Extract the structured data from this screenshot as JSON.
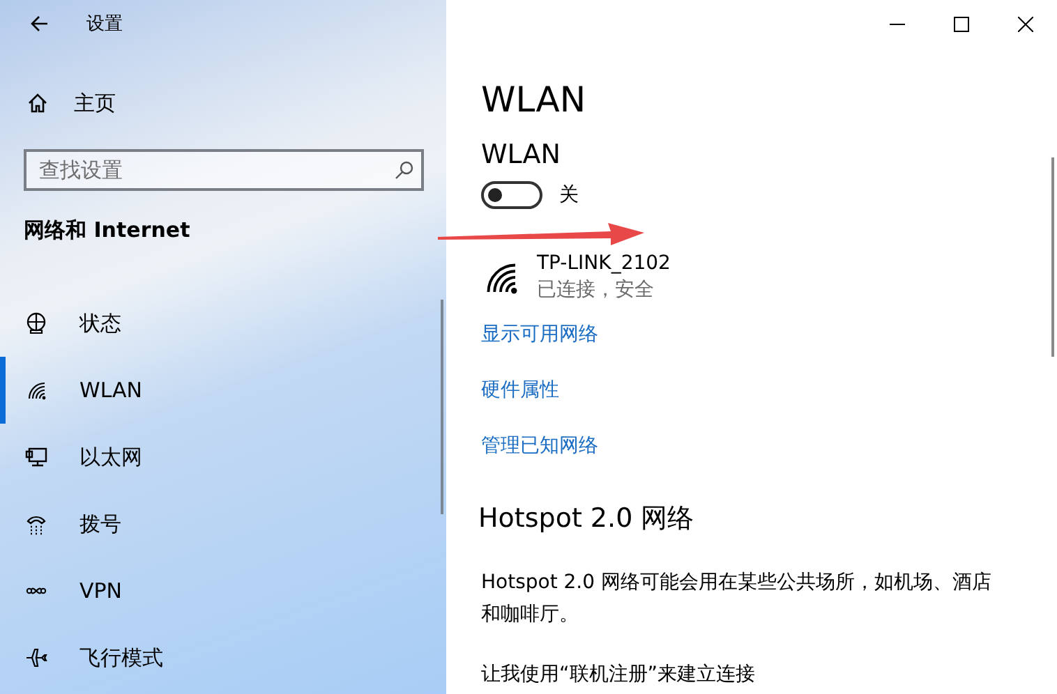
{
  "window": {
    "title": "设置"
  },
  "sidebar": {
    "home": {
      "label": "主页"
    },
    "search": {
      "placeholder": "查找设置"
    },
    "section_title": "网络和 Internet",
    "items": [
      {
        "label": "状态",
        "kind": "globe",
        "selected": false
      },
      {
        "label": "WLAN",
        "kind": "wifi",
        "selected": true
      },
      {
        "label": "以太网",
        "kind": "ethernet",
        "selected": false
      },
      {
        "label": "拨号",
        "kind": "dialup",
        "selected": false
      },
      {
        "label": "VPN",
        "kind": "vpn",
        "selected": false
      },
      {
        "label": "飞行模式",
        "kind": "airplane",
        "selected": false
      }
    ]
  },
  "main": {
    "title": "WLAN",
    "wlan": {
      "label": "WLAN",
      "on": false,
      "state_text": "关"
    },
    "network": {
      "name": "TP-LINK_2102",
      "status": "已连接，安全"
    },
    "links": [
      "显示可用网络",
      "硬件属性",
      "管理已知网络"
    ],
    "hotspot": {
      "heading": "Hotspot 2.0 网络",
      "description": "Hotspot 2.0 网络可能会用在某些公共场所，如机场、酒店和咖啡厅。",
      "option": "让我使用“联机注册”来建立连接"
    }
  }
}
